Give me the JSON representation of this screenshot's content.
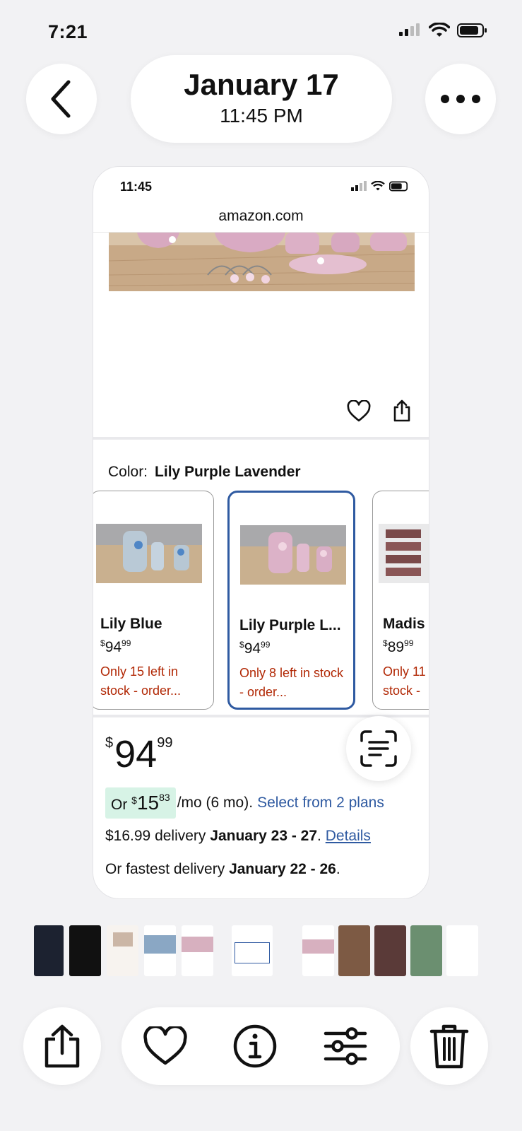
{
  "status": {
    "time": "7:21"
  },
  "header": {
    "date": "January 17",
    "time": "11:45 PM"
  },
  "screenshot": {
    "status_time": "11:45",
    "url": "amazon.com",
    "color_label": "Color:",
    "color_value": "Lily Purple Lavender",
    "variants": [
      {
        "name": "Lily Blue",
        "dollars": "94",
        "cents": "99",
        "stock": "Only 15 left in stock - order...",
        "selected": false
      },
      {
        "name": "Lily Purple L...",
        "dollars": "94",
        "cents": "99",
        "stock": "Only 8 left in stock - order...",
        "selected": true
      },
      {
        "name": "Madis",
        "dollars": "89",
        "cents": "99",
        "stock": "Only 11 stock -",
        "selected": false
      }
    ],
    "price": {
      "currency": "$",
      "dollars": "94",
      "cents": "99"
    },
    "monthly": {
      "prefix": "Or",
      "currency": "$",
      "dollars": "15",
      "cents": "83",
      "suffix": "/mo (6 mo).",
      "link": "Select from 2 plans"
    },
    "delivery": {
      "text": "$16.99 delivery",
      "dates": "January 23 - 27",
      "sep": ".",
      "link": "Details"
    },
    "fastest": {
      "text": "Or fastest delivery",
      "dates": "January 22 - 26",
      "end": "."
    }
  },
  "toolbar": {
    "share": "share-icon",
    "favorite": "heart-icon",
    "info": "info-icon",
    "adjust": "sliders-icon",
    "delete": "trash-icon"
  },
  "colors": {
    "link": "#2f5aa1",
    "stock": "#b12704",
    "selected_border": "#2f5aa1",
    "badge": "#d7f3e6"
  }
}
